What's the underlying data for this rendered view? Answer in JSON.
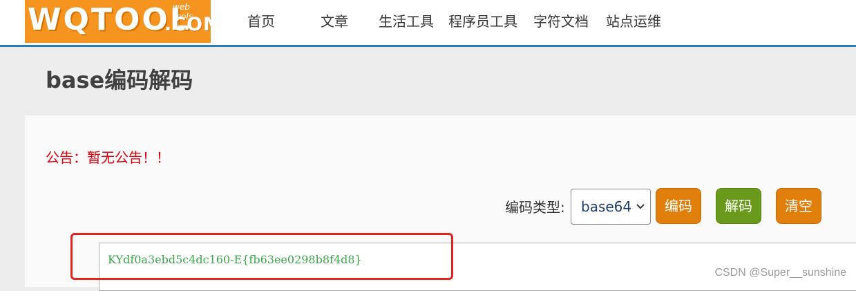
{
  "header": {
    "logo": {
      "main": "WQTOOL",
      "com": ".COM",
      "tagline": "web tools"
    },
    "nav": [
      {
        "label": "首页"
      },
      {
        "label": "文章"
      },
      {
        "label": "生活工具"
      },
      {
        "label": "程序员工具"
      },
      {
        "label": "字符文档"
      },
      {
        "label": "站点运维"
      }
    ]
  },
  "page": {
    "title": "base编码解码"
  },
  "notice": "公告：暂无公告！！",
  "controls": {
    "type_label": "编码类型:",
    "type_selected": "base64",
    "encode_label": "编码",
    "decode_label": "解码",
    "clear_label": "清空"
  },
  "textarea": {
    "value": "KYdf0a3ebd5c4dc160-E{fb63ee0298b8f4d8}"
  },
  "watermark": "CSDN @Super__sunshine",
  "colors": {
    "logo_bg": "#f5951f",
    "header_border": "#2b7bbd",
    "notice": "#e0000d",
    "encode_btn": "#e07f0c",
    "decode_btn": "#6a9a1b",
    "clear_btn": "#e07f0c",
    "text_output": "#3aa64a",
    "highlight": "#e3231e"
  }
}
